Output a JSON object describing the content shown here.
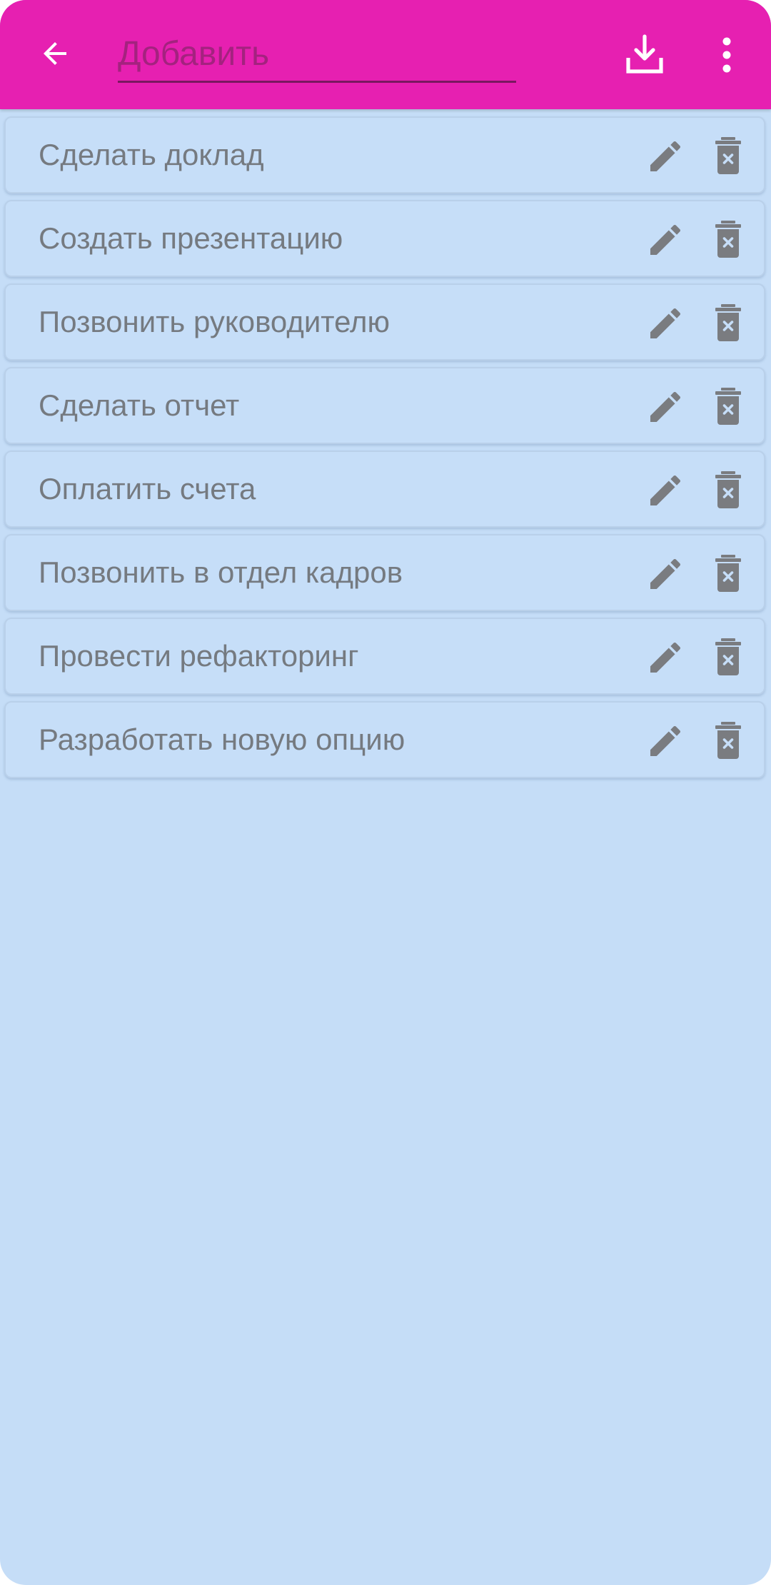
{
  "toolbar": {
    "background": "#e620b1",
    "back_icon": "arrow-left-icon",
    "add_input": {
      "placeholder": "Добавить",
      "value": ""
    },
    "download_icon": "download-icon",
    "more_icon": "more-vertical-icon"
  },
  "list": {
    "background": "#c5ddf7",
    "items": [
      {
        "label": "Сделать доклад"
      },
      {
        "label": "Создать презентацию"
      },
      {
        "label": "Позвонить руководителю"
      },
      {
        "label": "Сделать отчет"
      },
      {
        "label": "Оплатить счета"
      },
      {
        "label": "Позвонить в отдел кадров"
      },
      {
        "label": "Провести рефакторинг"
      },
      {
        "label": "Разработать новую опцию"
      }
    ],
    "edit_icon": "pencil-icon",
    "delete_icon": "trash-x-icon"
  }
}
